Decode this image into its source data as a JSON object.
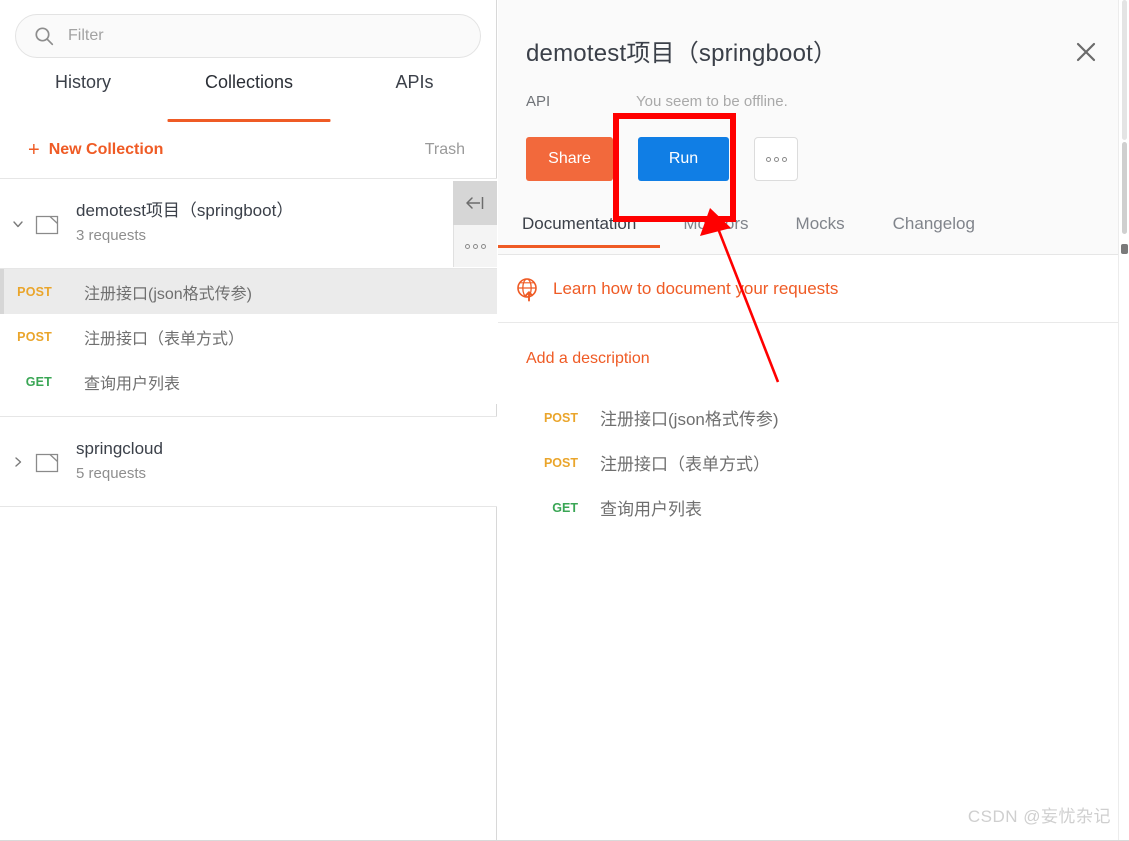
{
  "sidebar": {
    "search": {
      "placeholder": "Filter",
      "value": "",
      "icon": "search-icon"
    },
    "tabs": [
      {
        "label": "History",
        "active": false
      },
      {
        "label": "Collections",
        "active": true
      },
      {
        "label": "APIs",
        "active": false
      }
    ],
    "new_collection_label": "New Collection",
    "new_collection_icon": "plus-icon",
    "trash_label": "Trash",
    "collapse_icon": "collapse-sidebar-icon",
    "options_icon": "more-options-icon",
    "collections": [
      {
        "name": "demotest项目（springboot）",
        "count": "3 requests",
        "expanded": true,
        "requests": [
          {
            "method": "POST",
            "name": "注册接口(json格式传参)",
            "selected": true
          },
          {
            "method": "POST",
            "name": "注册接口（表单方式）",
            "selected": false
          },
          {
            "method": "GET",
            "name": "查询用户列表",
            "selected": false
          }
        ]
      },
      {
        "name": "springcloud",
        "count": "5 requests",
        "expanded": false,
        "requests": []
      }
    ]
  },
  "panel": {
    "title": "demotest项目（springboot）",
    "close_icon": "close-icon",
    "meta": {
      "api_label": "API",
      "status_text": "You seem to be offline."
    },
    "buttons": {
      "share": "Share",
      "run": "Run",
      "more": "more-actions-icon"
    },
    "tabs": [
      {
        "label": "Documentation",
        "active": true
      },
      {
        "label": "Monitors",
        "active": false
      },
      {
        "label": "Mocks",
        "active": false
      },
      {
        "label": "Changelog",
        "active": false
      }
    ],
    "learn": {
      "icon": "globe-upload-icon",
      "text": "Learn how to document your requests"
    },
    "description_placeholder": "Add a description",
    "documentation_requests": [
      {
        "method": "POST",
        "name": "注册接口(json格式传参)"
      },
      {
        "method": "POST",
        "name": "注册接口（表单方式）"
      },
      {
        "method": "GET",
        "name": "查询用户列表"
      }
    ]
  },
  "annotation": {
    "color": "#FF0000",
    "highlight_target": "Run",
    "shape": "rectangle-with-arrow"
  },
  "watermark": "CSDN @妄忧杂记",
  "colors": {
    "accent_orange": "#EF5B25",
    "share_orange": "#F2693C",
    "run_blue": "#107EE5",
    "post_yellow": "#EAA52B",
    "get_green": "#3AA655",
    "annotation_red": "#FF0000"
  }
}
